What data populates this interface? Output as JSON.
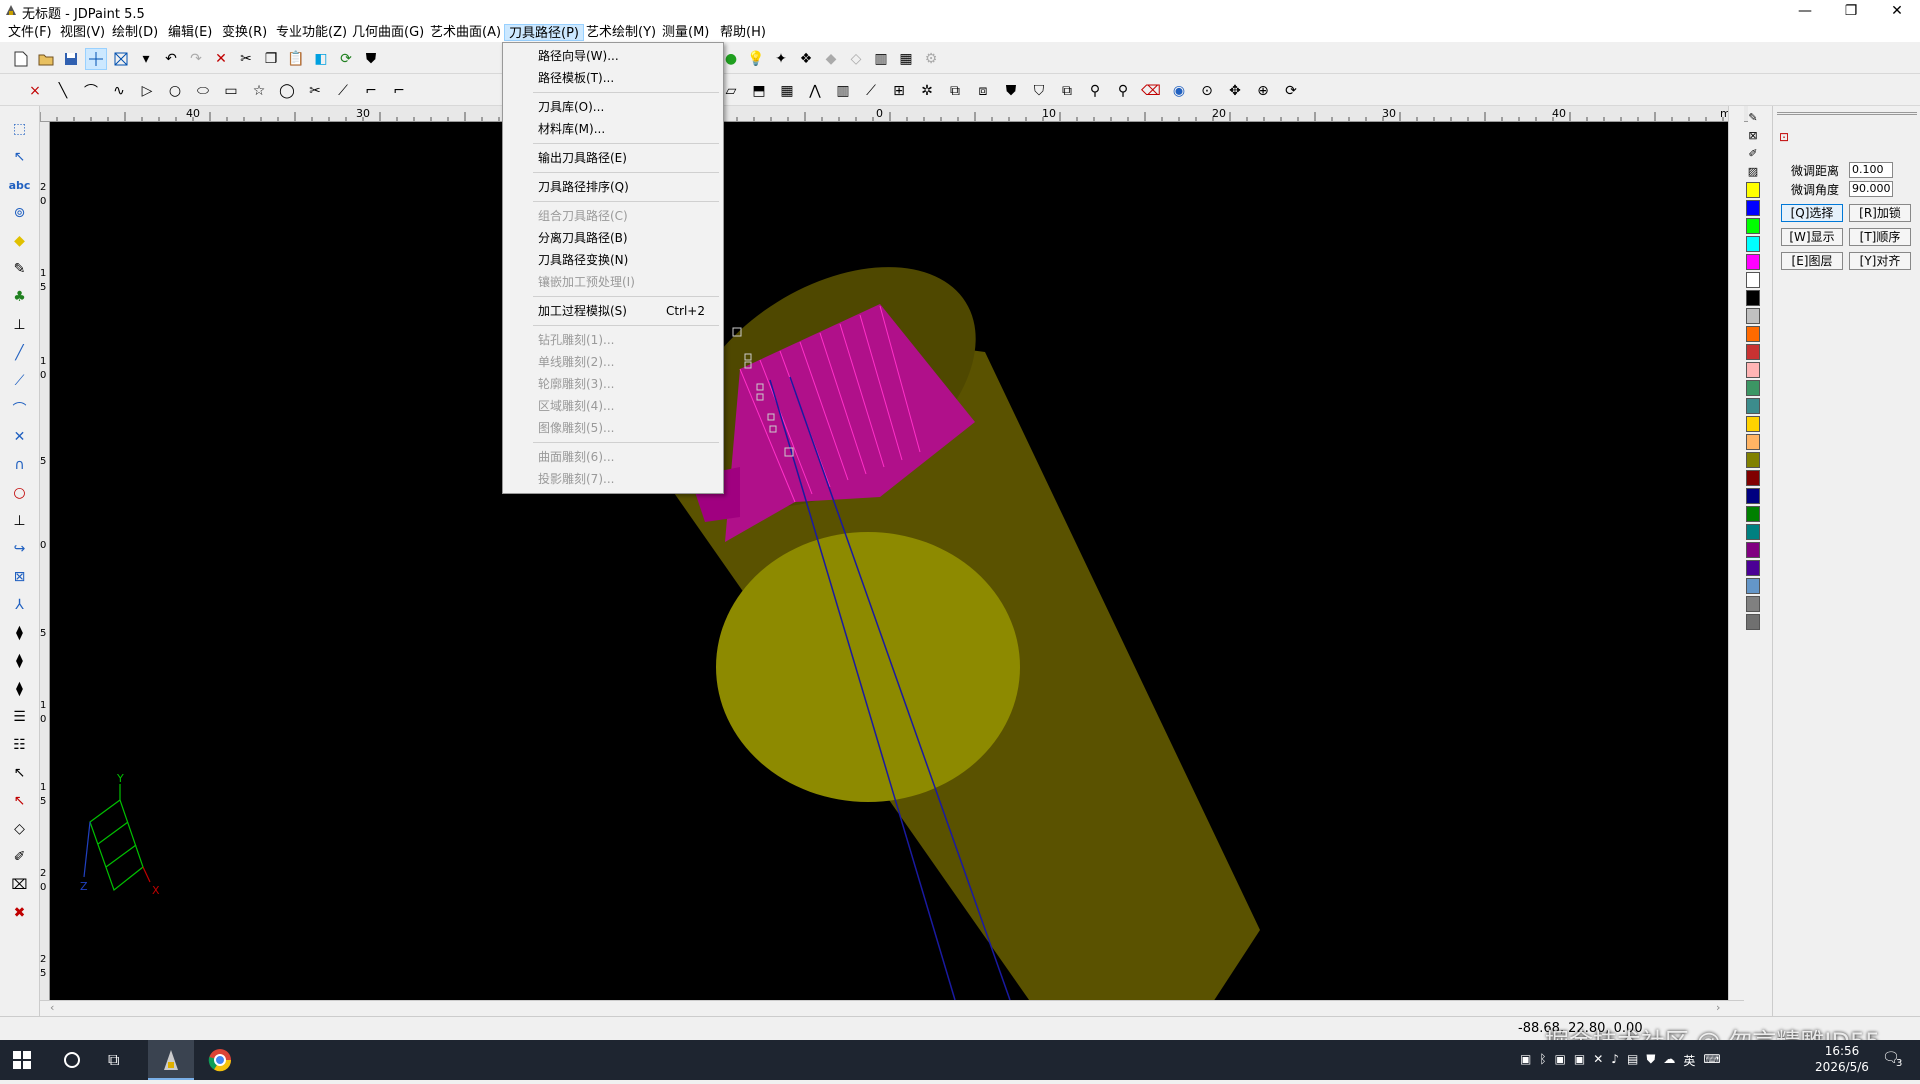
{
  "window": {
    "title": "无标题 - JDPaint 5.5",
    "minimize": "—",
    "restore": "❐",
    "close": "✕"
  },
  "menubar": [
    {
      "label": "文件(F)"
    },
    {
      "label": "视图(V)"
    },
    {
      "label": "绘制(D)"
    },
    {
      "label": "编辑(E)"
    },
    {
      "label": "变换(R)"
    },
    {
      "label": "专业功能(Z)"
    },
    {
      "label": "几何曲面(G)"
    },
    {
      "label": "艺术曲面(A)"
    },
    {
      "label": "刀具路径(P)"
    },
    {
      "label": "艺术绘制(Y)"
    },
    {
      "label": "测量(M)"
    },
    {
      "label": "帮助(H)"
    }
  ],
  "dropdown": {
    "items": [
      {
        "label": "路径向导(W)...",
        "disabled": false
      },
      {
        "label": "路径模板(T)...",
        "disabled": false
      },
      {
        "label": "刀具库(O)...",
        "disabled": false
      },
      {
        "label": "材料库(M)...",
        "disabled": false
      },
      {
        "label": "输出刀具路径(E)",
        "disabled": false
      },
      {
        "label": "刀具路径排序(Q)",
        "disabled": false
      },
      {
        "label": "组合刀具路径(C)",
        "disabled": true
      },
      {
        "label": "分离刀具路径(B)",
        "disabled": false
      },
      {
        "label": "刀具路径变换(N)",
        "disabled": false
      },
      {
        "label": "镶嵌加工预处理(I)",
        "disabled": true
      },
      {
        "label": "加工过程模拟(S)",
        "disabled": false,
        "shortcut": "Ctrl+2"
      },
      {
        "label": "钻孔雕刻(1)...",
        "disabled": true
      },
      {
        "label": "单线雕刻(2)...",
        "disabled": true
      },
      {
        "label": "轮廓雕刻(3)...",
        "disabled": true
      },
      {
        "label": "区域雕刻(4)...",
        "disabled": true
      },
      {
        "label": "图像雕刻(5)...",
        "disabled": true
      },
      {
        "label": "曲面雕刻(6)...",
        "disabled": true
      },
      {
        "label": "投影雕刻(7)...",
        "disabled": true
      }
    ]
  },
  "ruler": {
    "unit": "mm",
    "labels": [
      "40",
      "30",
      "0",
      "10",
      "20",
      "30",
      "40"
    ]
  },
  "ruler_v": {
    "labels": [
      "2",
      "0",
      "1",
      "5",
      "1",
      "0",
      "5",
      "0",
      "5",
      "1",
      "0",
      "1",
      "5",
      "2",
      "0",
      "2",
      "5"
    ]
  },
  "axis": {
    "y": "Y",
    "x": "X",
    "z": "Z"
  },
  "right_panel": {
    "fine_distance_label": "微调距离",
    "fine_distance_value": "0.100",
    "fine_angle_label": "微调角度",
    "fine_angle_value": "90.000",
    "buttons": [
      "[Q]选择",
      "[R]加锁",
      "[W]显示",
      "[T]顺序",
      "[E]图层",
      "[Y]对齐"
    ]
  },
  "palette": [
    "#ffff00",
    "#0000ff",
    "#00ff00",
    "#00ffff",
    "#ff00ff",
    "#ffffff",
    "#000000",
    "#c0c0c0",
    "#ff6a00",
    "#c83232",
    "#ffb4b4",
    "#3c9664",
    "#3c8c8c",
    "#ffd200",
    "#ffb464",
    "#808000",
    "#800000",
    "#000080",
    "#008000",
    "#008080",
    "#800080",
    "#4b0096",
    "#6496c8",
    "#808080",
    "#707070"
  ],
  "status": {
    "coords": "-88.68, 22.80, 0.00"
  },
  "watermark": "掘金技术社区 @ 勿言精雕JD55",
  "taskbar": {
    "time": "16:56",
    "date": "2026/5/6",
    "ime": "英",
    "notifications": "3"
  }
}
